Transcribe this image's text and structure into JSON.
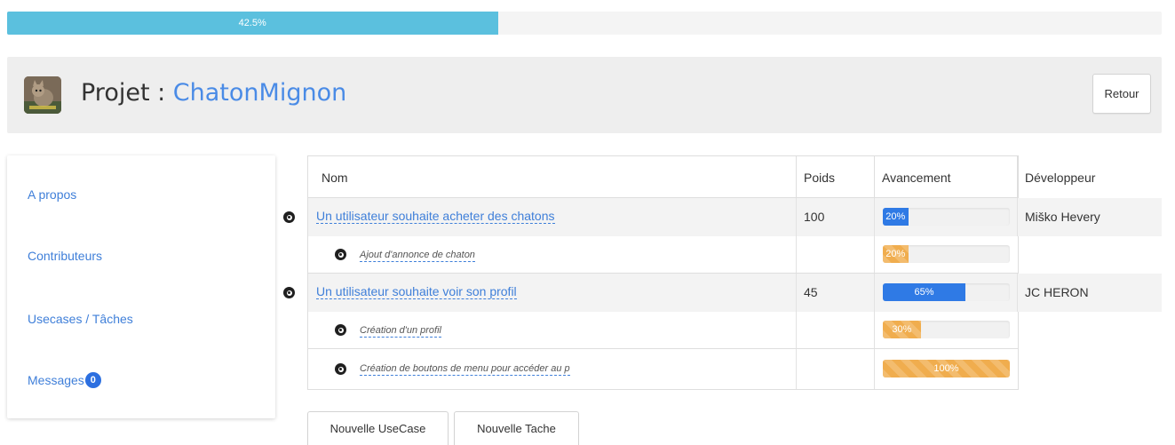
{
  "overall_progress": {
    "label": "42.5%",
    "fraction": 0.425
  },
  "header": {
    "title_prefix": "Projet : ",
    "project_name": "ChatonMignon",
    "back_button": "Retour"
  },
  "sidebar": {
    "items": [
      {
        "label": "A propos"
      },
      {
        "label": "Contributeurs"
      },
      {
        "label": "Usecases / Tâches"
      },
      {
        "label": "Messages",
        "badge": "0"
      }
    ]
  },
  "table": {
    "columns": [
      "Nom",
      "Poids",
      "Avancement",
      "Développeur"
    ],
    "rows": [
      {
        "kind": "usecase",
        "name": "Un utilisateur souhaite acheter des chatons",
        "poids": "100",
        "progress_label": "20%",
        "progress": 0.2,
        "color": "blue",
        "developer": "Miško Hevery"
      },
      {
        "kind": "task",
        "name": "Ajout d'annonce de chaton",
        "poids": "",
        "progress_label": "20%",
        "progress": 0.2,
        "color": "orange",
        "developer": ""
      },
      {
        "kind": "usecase",
        "name": "Un utilisateur souhaite voir son profil",
        "poids": "45",
        "progress_label": "65%",
        "progress": 0.65,
        "color": "blue",
        "developer": "JC HERON"
      },
      {
        "kind": "task",
        "name": "Création d'un profil",
        "poids": "",
        "progress_label": "30%",
        "progress": 0.3,
        "color": "orange",
        "developer": ""
      },
      {
        "kind": "task",
        "name": "Création de boutons de menu pour accéder au p",
        "poids": "",
        "progress_label": "100%",
        "progress": 1.0,
        "color": "orange",
        "developer": ""
      }
    ]
  },
  "actions": {
    "new_usecase": "Nouvelle UseCase",
    "new_task": "Nouvelle Tache"
  },
  "colors": {
    "accent": "#4a8be6",
    "progress_info": "#5bc0de",
    "progress_blue": "#2f7ae5",
    "progress_orange": "#f0ad4e"
  }
}
